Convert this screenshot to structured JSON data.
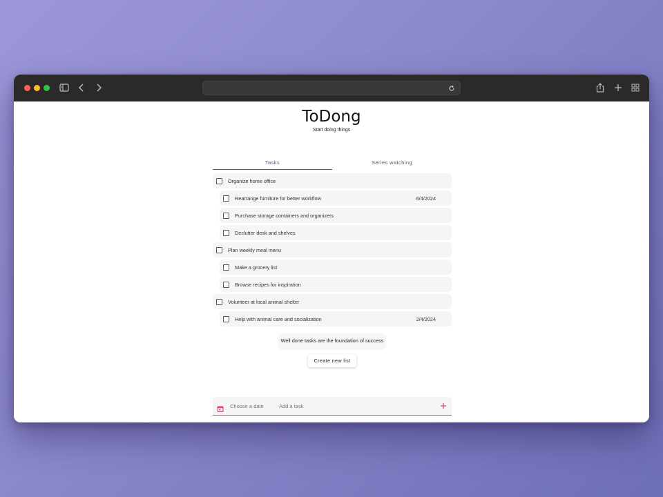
{
  "app": {
    "title": "ToDong",
    "subtitle": "Start doing things"
  },
  "tabs": [
    {
      "label": "Tasks",
      "active": true
    },
    {
      "label": "Series watching",
      "active": false
    }
  ],
  "tasks": [
    {
      "label": "Organize home office",
      "date": "",
      "level": 0
    },
    {
      "label": "Rearrange furniture for better workflow",
      "date": "6/4/2024",
      "level": 1
    },
    {
      "label": "Purchase storage containers and organizers",
      "date": "",
      "level": 1
    },
    {
      "label": "Declutter desk and shelves",
      "date": "",
      "level": 1
    },
    {
      "label": "Plan weekly meal menu",
      "date": "",
      "level": 0
    },
    {
      "label": "Make a grocery list",
      "date": "",
      "level": 1
    },
    {
      "label": "Browse recipes for inspiration",
      "date": "",
      "level": 1
    },
    {
      "label": "Volunteer at local animal shelter",
      "date": "",
      "level": 0
    },
    {
      "label": "Help with animal care and socialization",
      "date": "2/4/2024",
      "level": 1
    }
  ],
  "motivation": "Well done tasks are the foundation of success",
  "create_list_label": "Create new list",
  "add_bar": {
    "date_placeholder": "Choose a date",
    "task_placeholder": "Add a task"
  },
  "colors": {
    "accent": "#3f51b5",
    "add_icon": "#e0416c",
    "toolbar": "#2c2a29"
  },
  "icons": {
    "sidebar": "sidebar-icon",
    "back": "chevron-left-icon",
    "forward": "chevron-right-icon",
    "reload": "reload-icon",
    "share": "share-icon",
    "new_tab": "plus-icon",
    "tabs_overview": "grid-icon",
    "calendar": "calendar-icon",
    "add": "plus-icon"
  }
}
